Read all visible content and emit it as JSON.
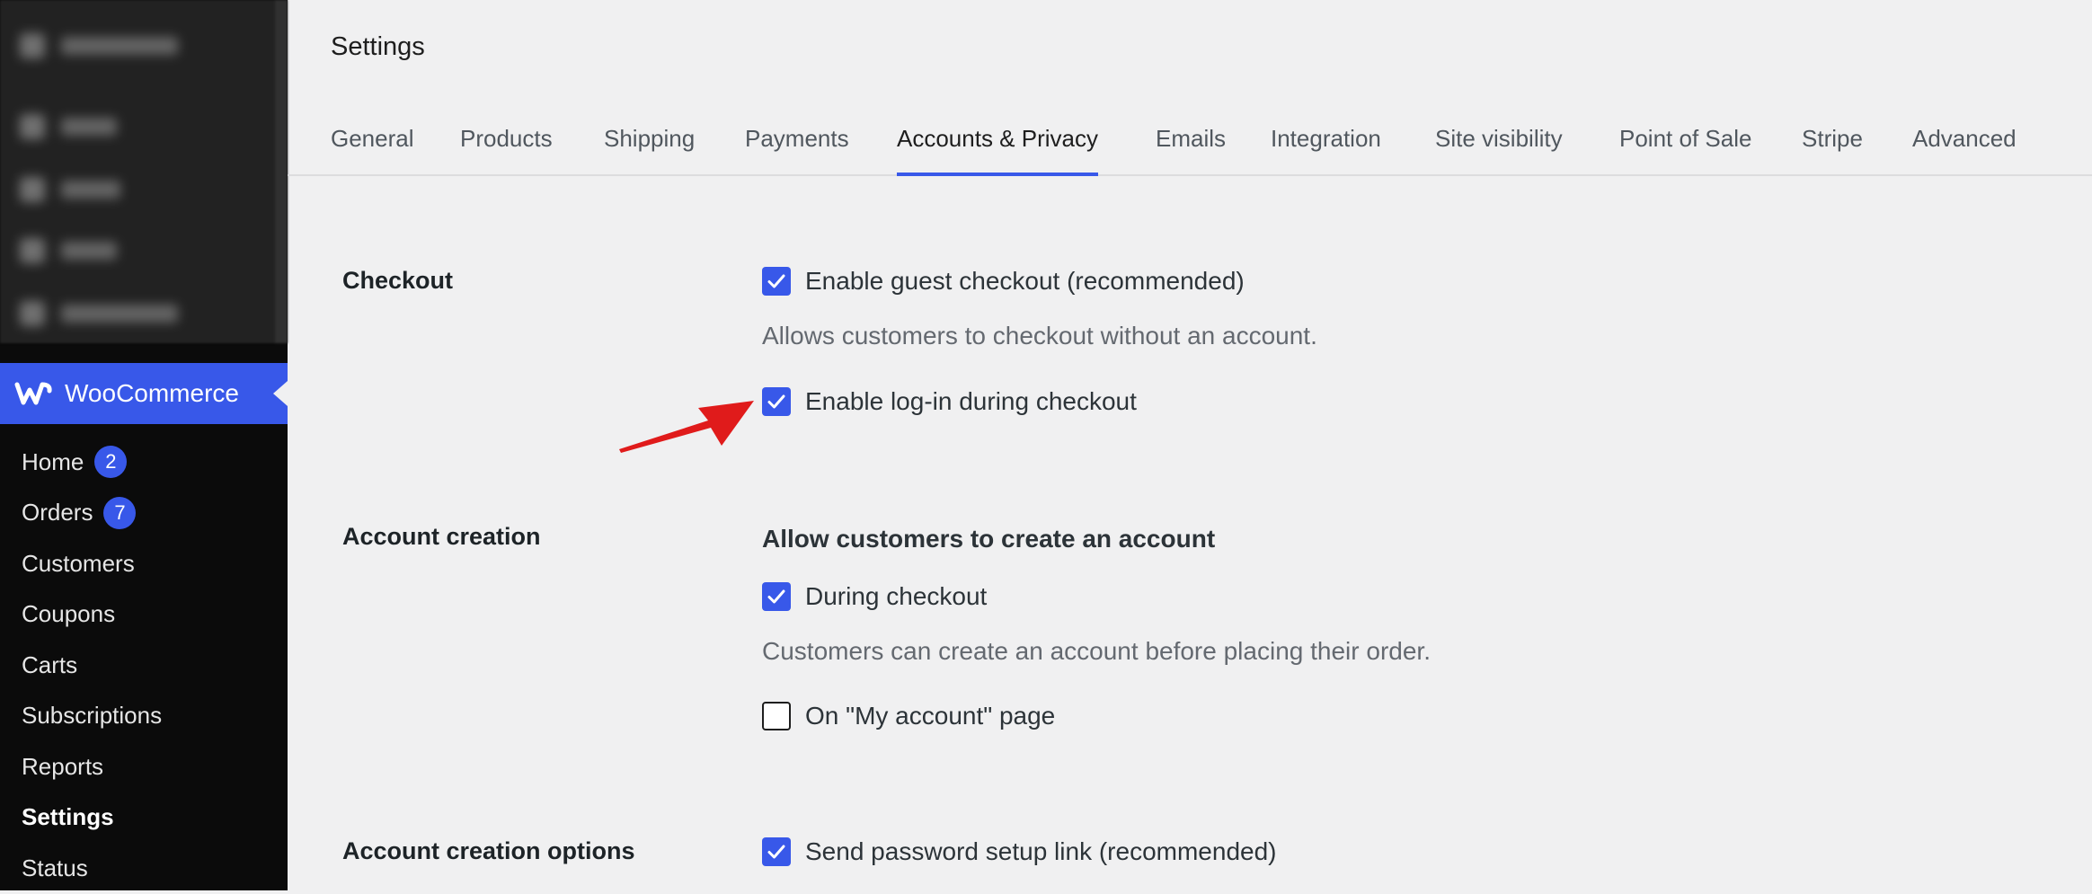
{
  "sidebar": {
    "blurred_item_count": 5,
    "woocommerce": {
      "title": "WooCommerce",
      "logo_icon": "woo-logo-icon"
    },
    "items": [
      {
        "label": "Home",
        "badge": "2",
        "current": false
      },
      {
        "label": "Orders",
        "badge": "7",
        "current": false
      },
      {
        "label": "Customers",
        "current": false
      },
      {
        "label": "Coupons",
        "current": false
      },
      {
        "label": "Carts",
        "current": false
      },
      {
        "label": "Subscriptions",
        "current": false
      },
      {
        "label": "Reports",
        "current": false
      },
      {
        "label": "Settings",
        "current": true
      },
      {
        "label": "Status",
        "current": false
      }
    ]
  },
  "page": {
    "title": "Settings"
  },
  "tabs": [
    {
      "label": "General",
      "active": false
    },
    {
      "label": "Products",
      "active": false
    },
    {
      "label": "Shipping",
      "active": false
    },
    {
      "label": "Payments",
      "active": false
    },
    {
      "label": "Accounts & Privacy",
      "active": true
    },
    {
      "label": "Emails",
      "active": false
    },
    {
      "label": "Integration",
      "active": false
    },
    {
      "label": "Site visibility",
      "active": false
    },
    {
      "label": "Point of Sale",
      "active": false
    },
    {
      "label": "Stripe",
      "active": false
    },
    {
      "label": "Advanced",
      "active": false
    }
  ],
  "sections": {
    "checkout": {
      "label": "Checkout",
      "guest_checkout": {
        "label": "Enable guest checkout (recommended)",
        "checked": true
      },
      "guest_checkout_desc": "Allows customers to checkout without an account.",
      "login_checkout": {
        "label": "Enable log-in during checkout",
        "checked": true
      }
    },
    "account_creation": {
      "label": "Account creation",
      "subheading": "Allow customers to create an account",
      "during_checkout": {
        "label": "During checkout",
        "checked": true
      },
      "during_checkout_desc": "Customers can create an account before placing their order.",
      "my_account_page": {
        "label": "On \"My account\" page",
        "checked": false
      }
    },
    "account_creation_options": {
      "label": "Account creation options",
      "password_setup_link": {
        "label": "Send password setup link (recommended)",
        "checked": true
      }
    }
  },
  "annotation": {
    "arrow_color": "#e01b1b"
  },
  "colors": {
    "accent": "#3858e9",
    "sidebar_bg": "#0b0b0b",
    "page_bg": "#f0f0f1"
  }
}
